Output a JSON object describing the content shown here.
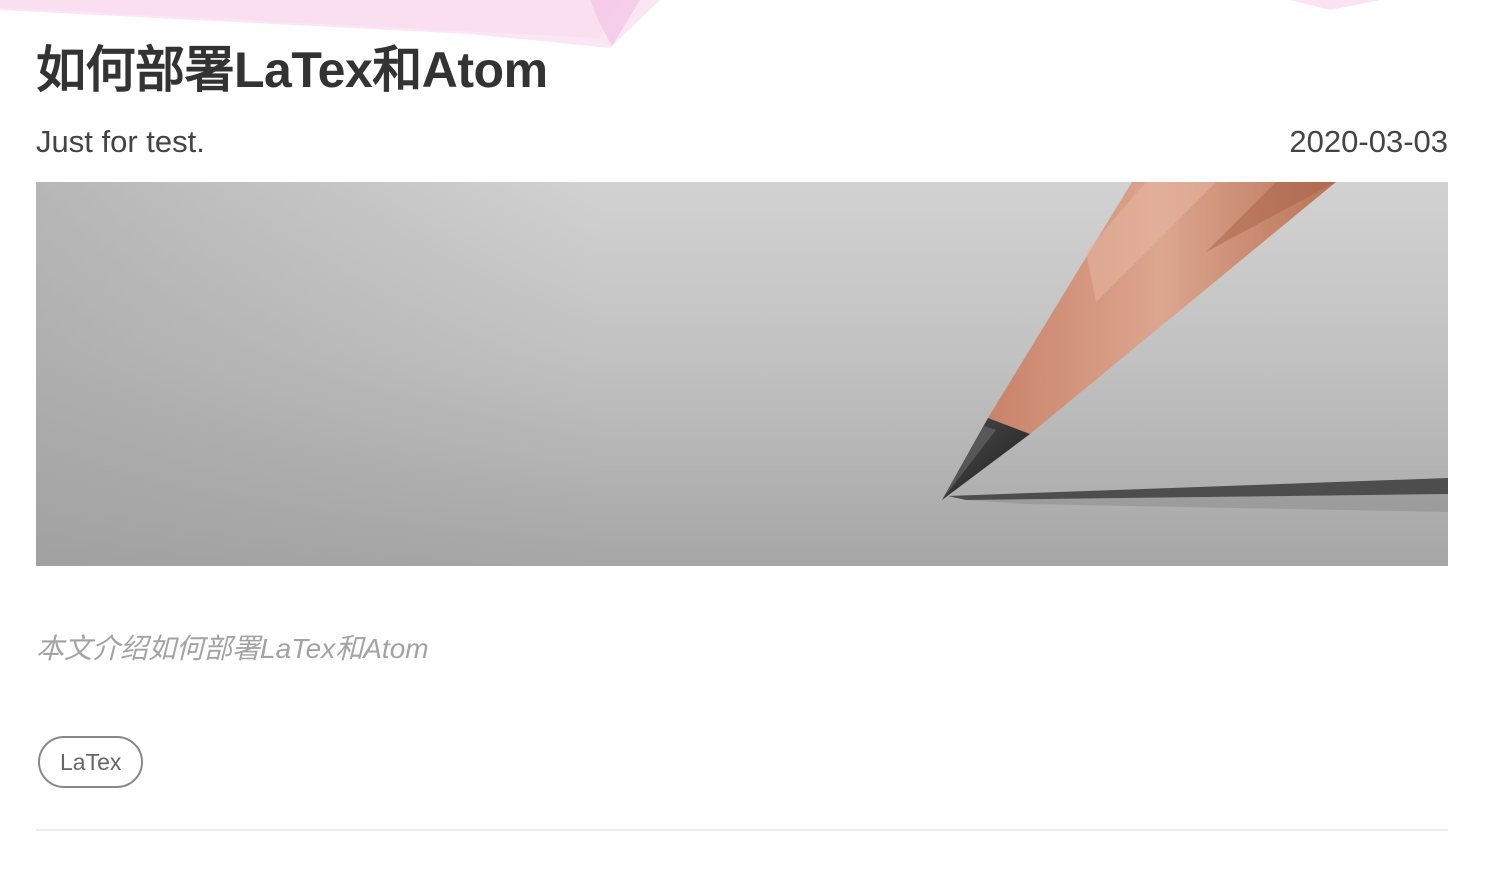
{
  "post": {
    "title": "如何部署LaTex和Atom",
    "subtitle": "Just for test.",
    "date": "2020-03-03",
    "excerpt": "本文介绍如何部署LaTex和Atom",
    "tags": [
      "LaTex"
    ]
  },
  "cover_image": {
    "icon": "pencil-on-paper-photo"
  },
  "colors": {
    "title": "#333333",
    "excerpt": "#a3a3a3",
    "tag_border": "#888888",
    "divider": "#ececec",
    "decoration": "#f7d6ee"
  }
}
